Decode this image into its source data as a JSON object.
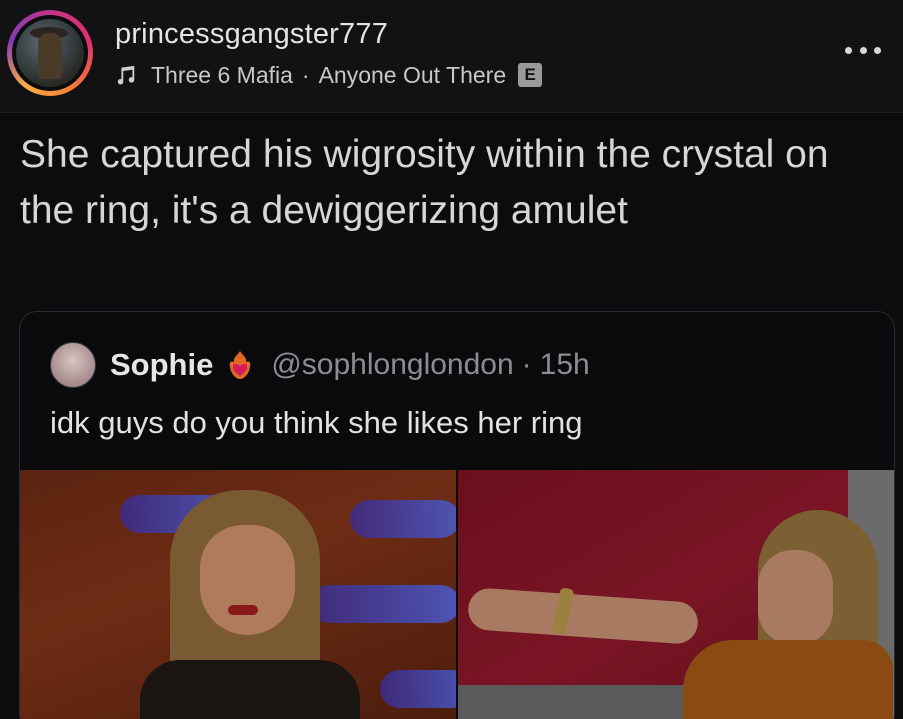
{
  "header": {
    "username": "princessgangster777",
    "music": {
      "icon": "music-note-icon",
      "artist": "Three 6 Mafia",
      "separator": "·",
      "track": "Anyone Out There",
      "explicit_badge": "E"
    },
    "more_icon": "more-dots-icon"
  },
  "caption": "She captured his wigrosity within the crystal on the ring, it's a dewiggerizing amulet",
  "quote": {
    "name": "Sophie",
    "badge_icon": "heart-fire-emoji-icon",
    "handle": "@sophlonglondon",
    "separator": "·",
    "time": "15h",
    "text": "idk guys do you think she likes her ring"
  },
  "colors": {
    "background": "#0c0c0e",
    "text_primary": "#e4e4e4",
    "text_secondary": "#8b8d90",
    "card_border": "#2d2d31"
  }
}
